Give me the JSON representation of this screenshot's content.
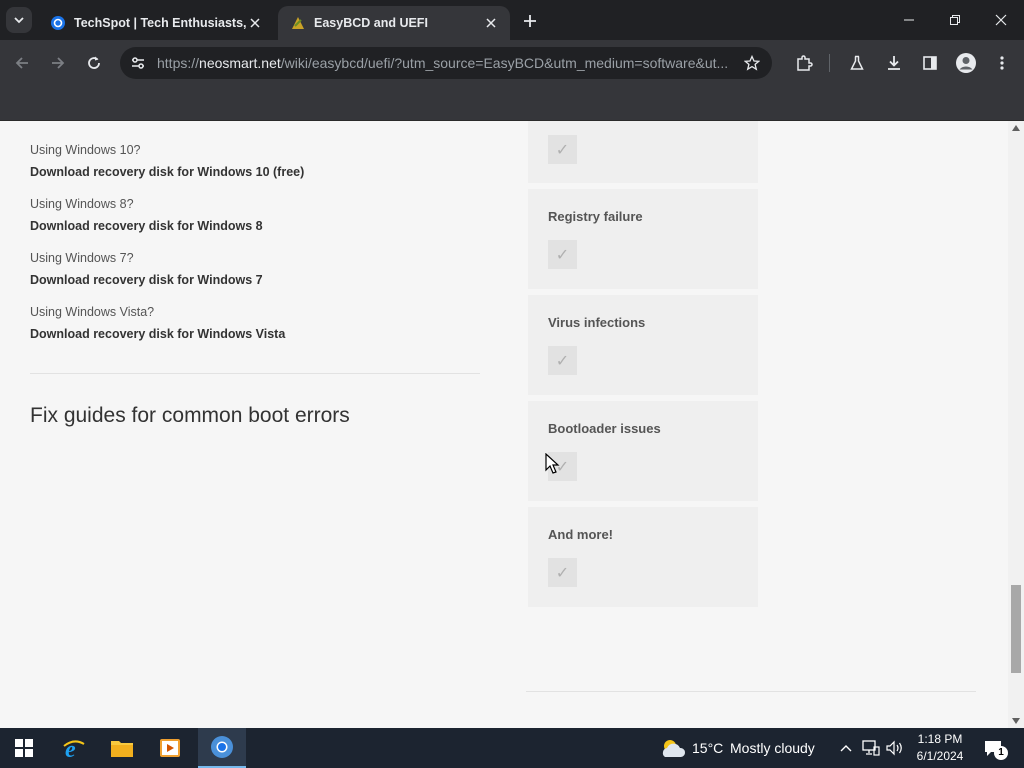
{
  "browser": {
    "tabs": [
      {
        "title": "TechSpot | Tech Enthusiasts, Po",
        "favicon": "techspot-icon",
        "active": false
      },
      {
        "title": "EasyBCD and UEFI",
        "favicon": "easybcd-icon",
        "active": true
      }
    ],
    "url_host": "neosmart.net",
    "url_prefix": "https://",
    "url_rest": "/wiki/easybcd/uefi/?utm_source=EasyBCD&utm_medium=software&ut..."
  },
  "content": {
    "downloads": [
      {
        "question": "Using Windows 10?",
        "link": "Download recovery disk for Windows 10 (free)"
      },
      {
        "question": "Using Windows 8?",
        "link": "Download recovery disk for Windows 8"
      },
      {
        "question": "Using Windows 7?",
        "link": "Download recovery disk for Windows 7"
      },
      {
        "question": "Using Windows Vista?",
        "link": "Download recovery disk for Windows Vista"
      }
    ],
    "fix_heading": "Fix guides for common boot errors",
    "features": [
      {
        "label": ""
      },
      {
        "label": "Registry failure"
      },
      {
        "label": "Virus infections"
      },
      {
        "label": "Bootloader issues"
      },
      {
        "label": "And more!"
      }
    ],
    "check_glyph": "✓"
  },
  "taskbar": {
    "weather_temp": "15°C",
    "weather_desc": "Mostly cloudy",
    "time": "1:18 PM",
    "date": "6/1/2024",
    "notification_count": "1"
  }
}
